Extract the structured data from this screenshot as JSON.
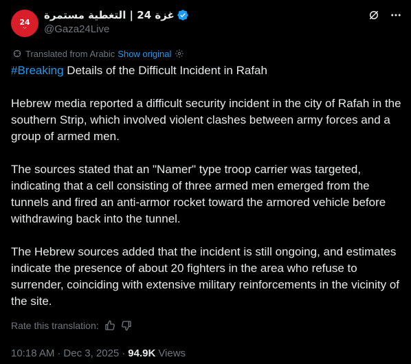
{
  "account": {
    "avatar_big": "24",
    "avatar_small": "غزة",
    "display_name": "غزة 24 | التغطية مستمرة",
    "handle": "@Gaza24Live",
    "verified_color": "#1d9bf0"
  },
  "icons": {
    "grok": "grok-icon",
    "more": "more-icon",
    "translate": "translate-icon",
    "settings": "gear-icon",
    "thumbs_up": "thumbs-up-icon",
    "thumbs_down": "thumbs-down-icon"
  },
  "translation": {
    "label": "Translated from Arabic",
    "show_original": "Show original"
  },
  "post": {
    "hashtag": "#Breaking",
    "headline": " Details of the Difficult Incident in Rafah",
    "paragraph1": "Hebrew media reported a difficult security incident in the city of Rafah in the southern Strip, which involved violent clashes between army forces and a group of armed men.",
    "paragraph2": "The sources stated that an \"Namer\" type troop carrier was targeted, indicating that a cell consisting of three armed men emerged from the tunnels and fired an anti-armor rocket toward the armored vehicle before withdrawing back into the tunnel.",
    "paragraph3": "The Hebrew sources added that the incident is still ongoing, and estimates indicate the presence of about 20 fighters in the area who refuse to surrender, coinciding with extensive military reinforcements in the vicinity of the site."
  },
  "rating": {
    "label": "Rate this translation:"
  },
  "meta": {
    "time": "10:18 AM",
    "date": "Dec 3, 2025",
    "separator": "·",
    "views_count": "94.9K",
    "views_label": "Views"
  },
  "colors": {
    "background": "#000000",
    "text": "#e7e9ea",
    "muted": "#71767b",
    "accent": "#1d9bf0",
    "avatar": "#d81e28"
  }
}
